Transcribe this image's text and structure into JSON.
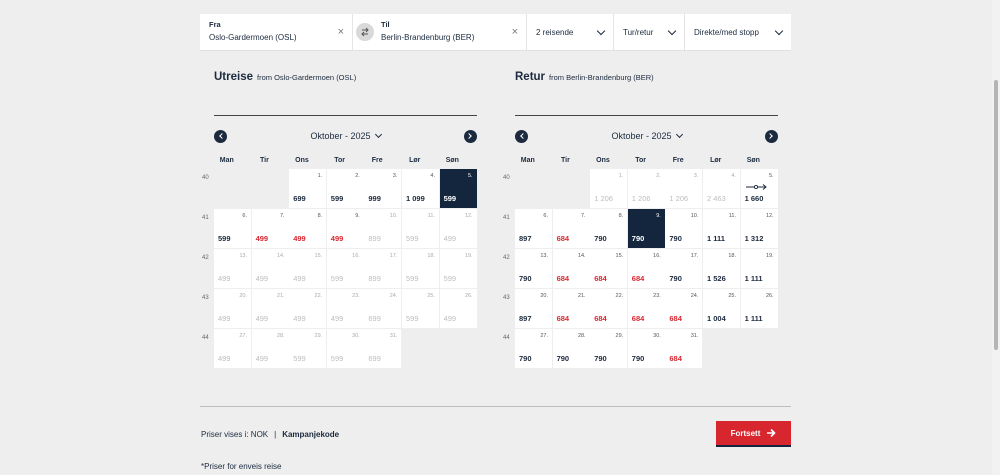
{
  "search": {
    "from_label": "Fra",
    "from_value": "Oslo-Gardermoen (OSL)",
    "to_label": "Til",
    "to_value": "Berlin-Brandenburg (BER)",
    "travelers": "2 reisende",
    "trip_type": "Tur/retur",
    "stops": "Direkte/med stopp",
    "clear_glyph": "×"
  },
  "outbound": {
    "title": "Utreise",
    "subtitle": "from Oslo-Gardermoen (OSL)",
    "month": "Oktober - 2025"
  },
  "return": {
    "title": "Retur",
    "subtitle": "from Berlin-Brandenburg (BER)",
    "month": "Oktober - 2025"
  },
  "weekdays": [
    "Man",
    "Tir",
    "Ons",
    "Tor",
    "Fre",
    "Lør",
    "Søn"
  ],
  "weeks": [
    "40",
    "41",
    "42",
    "43",
    "44"
  ],
  "outbound_days": [
    {
      "day": "1.",
      "price": "699",
      "state": "normal"
    },
    {
      "day": "2.",
      "price": "599",
      "state": "normal"
    },
    {
      "day": "3.",
      "price": "999",
      "state": "normal"
    },
    {
      "day": "4.",
      "price": "1 099",
      "state": "normal"
    },
    {
      "day": "5.",
      "price": "599",
      "state": "selected"
    },
    {
      "day": "6.",
      "price": "599",
      "state": "normal"
    },
    {
      "day": "7.",
      "price": "499",
      "state": "red"
    },
    {
      "day": "8.",
      "price": "499",
      "state": "red"
    },
    {
      "day": "9.",
      "price": "499",
      "state": "red"
    },
    {
      "day": "10.",
      "price": "899",
      "state": "gray"
    },
    {
      "day": "11.",
      "price": "599",
      "state": "gray"
    },
    {
      "day": "12.",
      "price": "499",
      "state": "gray"
    },
    {
      "day": "13.",
      "price": "499",
      "state": "gray"
    },
    {
      "day": "14.",
      "price": "499",
      "state": "gray"
    },
    {
      "day": "15.",
      "price": "499",
      "state": "gray"
    },
    {
      "day": "16.",
      "price": "599",
      "state": "gray"
    },
    {
      "day": "17.",
      "price": "899",
      "state": "gray"
    },
    {
      "day": "18.",
      "price": "599",
      "state": "gray"
    },
    {
      "day": "19.",
      "price": "599",
      "state": "gray"
    },
    {
      "day": "20.",
      "price": "499",
      "state": "gray"
    },
    {
      "day": "21.",
      "price": "499",
      "state": "gray"
    },
    {
      "day": "22.",
      "price": "499",
      "state": "gray"
    },
    {
      "day": "23.",
      "price": "499",
      "state": "gray"
    },
    {
      "day": "24.",
      "price": "699",
      "state": "gray"
    },
    {
      "day": "25.",
      "price": "599",
      "state": "gray"
    },
    {
      "day": "26.",
      "price": "499",
      "state": "gray"
    },
    {
      "day": "27.",
      "price": "499",
      "state": "gray"
    },
    {
      "day": "28.",
      "price": "499",
      "state": "gray"
    },
    {
      "day": "29.",
      "price": "599",
      "state": "gray"
    },
    {
      "day": "30.",
      "price": "599",
      "state": "gray"
    },
    {
      "day": "31.",
      "price": "699",
      "state": "gray"
    }
  ],
  "return_days": [
    {
      "day": "1.",
      "price": "1 206",
      "state": "gray"
    },
    {
      "day": "2.",
      "price": "1 206",
      "state": "gray"
    },
    {
      "day": "3.",
      "price": "1 206",
      "state": "gray"
    },
    {
      "day": "4.",
      "price": "2 463",
      "state": "gray"
    },
    {
      "day": "5.",
      "price": "1 660",
      "state": "normal",
      "arrow": true
    },
    {
      "day": "6.",
      "price": "897",
      "state": "normal"
    },
    {
      "day": "7.",
      "price": "684",
      "state": "red"
    },
    {
      "day": "8.",
      "price": "790",
      "state": "normal"
    },
    {
      "day": "9.",
      "price": "790",
      "state": "selected"
    },
    {
      "day": "10.",
      "price": "790",
      "state": "normal"
    },
    {
      "day": "11.",
      "price": "1 111",
      "state": "normal"
    },
    {
      "day": "12.",
      "price": "1 312",
      "state": "normal"
    },
    {
      "day": "13.",
      "price": "790",
      "state": "normal"
    },
    {
      "day": "14.",
      "price": "684",
      "state": "red"
    },
    {
      "day": "15.",
      "price": "684",
      "state": "red"
    },
    {
      "day": "16.",
      "price": "684",
      "state": "red"
    },
    {
      "day": "17.",
      "price": "790",
      "state": "normal"
    },
    {
      "day": "18.",
      "price": "1 526",
      "state": "normal"
    },
    {
      "day": "19.",
      "price": "1 111",
      "state": "normal"
    },
    {
      "day": "20.",
      "price": "897",
      "state": "normal"
    },
    {
      "day": "21.",
      "price": "684",
      "state": "red"
    },
    {
      "day": "22.",
      "price": "684",
      "state": "red"
    },
    {
      "day": "23.",
      "price": "684",
      "state": "red"
    },
    {
      "day": "24.",
      "price": "684",
      "state": "red"
    },
    {
      "day": "25.",
      "price": "1 004",
      "state": "normal"
    },
    {
      "day": "26.",
      "price": "1 111",
      "state": "normal"
    },
    {
      "day": "27.",
      "price": "790",
      "state": "normal"
    },
    {
      "day": "28.",
      "price": "790",
      "state": "normal"
    },
    {
      "day": "29.",
      "price": "790",
      "state": "normal"
    },
    {
      "day": "30.",
      "price": "790",
      "state": "normal"
    },
    {
      "day": "31.",
      "price": "684",
      "state": "red"
    }
  ],
  "footer": {
    "currency_text": "Priser vises i: NOK",
    "separator": "|",
    "campaign_code": "Kampanjekode",
    "continue_label": "Fortsett",
    "note": "*Priser for enveis reise"
  },
  "colors": {
    "navy": "#14263d",
    "red": "#d7262e",
    "muted": "#bdbdbd"
  },
  "icons": {
    "swap": "swap-arrows-icon",
    "prev": "chevron-left-icon",
    "next": "chevron-right-icon",
    "continue": "arrow-right-icon"
  }
}
